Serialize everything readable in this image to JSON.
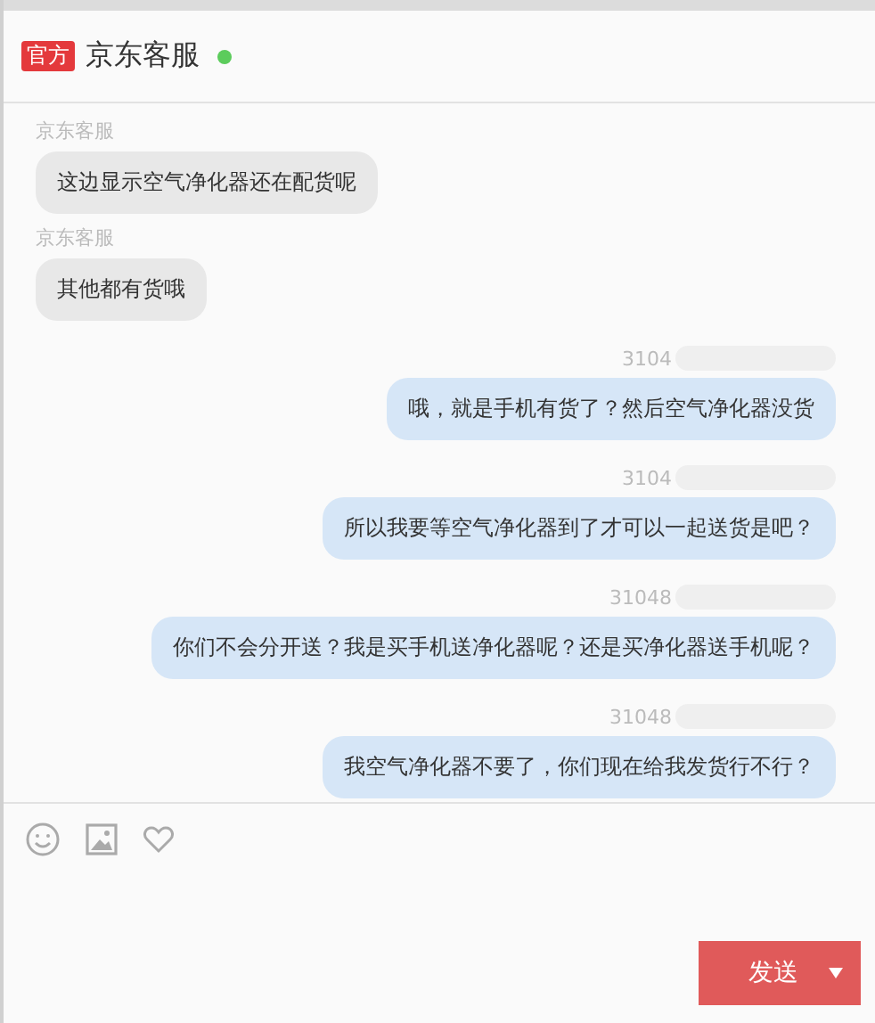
{
  "header": {
    "badge": "官方",
    "title": "京东客服",
    "online": true
  },
  "messages": [
    {
      "kind": "incoming",
      "sender": "京东客服",
      "text": "这边显示空气净化器还在配货呢"
    },
    {
      "kind": "incoming",
      "sender": "京东客服",
      "text": "其他都有货哦"
    },
    {
      "kind": "outgoing",
      "sender": "3104",
      "text": "哦，就是手机有货了？然后空气净化器没货"
    },
    {
      "kind": "outgoing",
      "sender": "3104",
      "text": "所以我要等空气净化器到了才可以一起送货是吧？"
    },
    {
      "kind": "outgoing",
      "sender": "31048",
      "text": "你们不会分开送？我是买手机送净化器呢？还是买净化器送手机呢？"
    },
    {
      "kind": "outgoing",
      "sender": "31048",
      "text": "我空气净化器不要了，你们现在给我发货行不行？"
    }
  ],
  "composer": {
    "send_label": "发送"
  }
}
